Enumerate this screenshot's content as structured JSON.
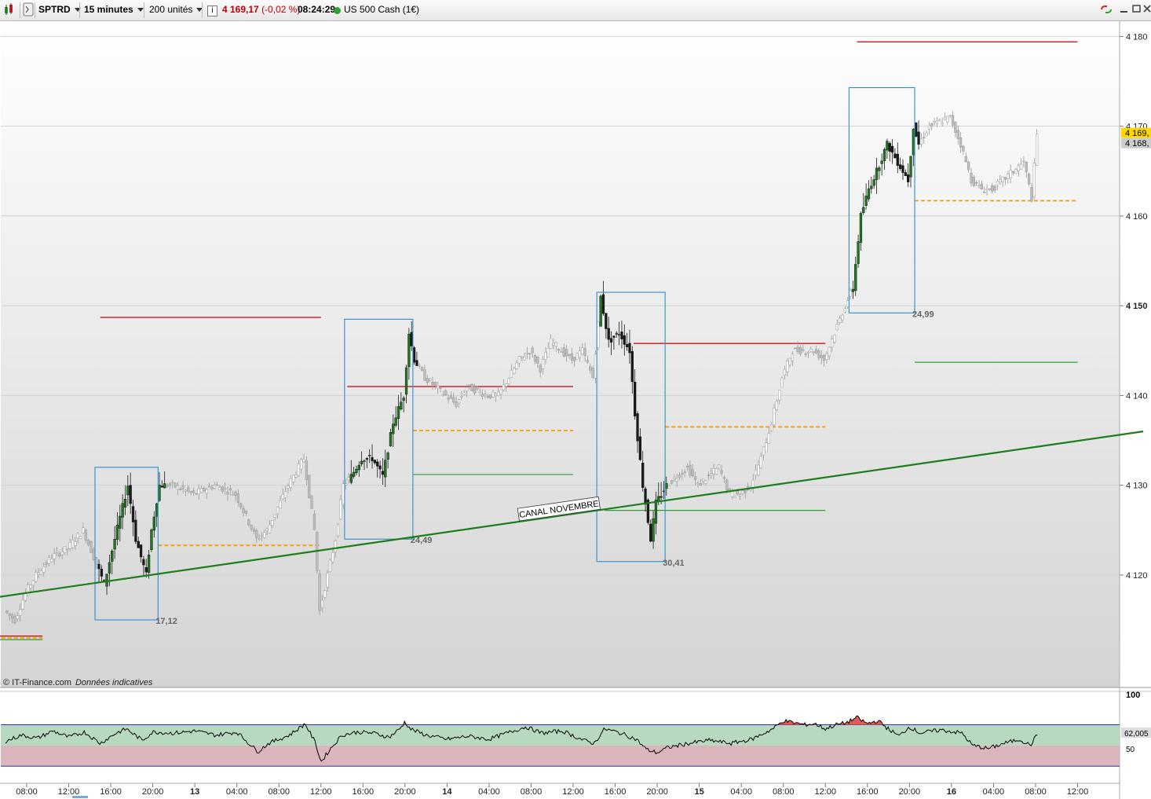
{
  "toolbar": {
    "symbol": "SPTRD",
    "interval": "15 minutes",
    "units": "200 unités",
    "info_icon": "i",
    "price": "4 169,17",
    "change": "(-0,02 %)",
    "time": "08:24:29",
    "instrument": "US 500 Cash (1€)",
    "icons": [
      "chart-type-icon",
      "indicator-icon",
      "info-icon",
      "status-dot-icon",
      "link-icon",
      "minimize-icon",
      "maximize-icon",
      "close-icon"
    ],
    "colors": {
      "price": "#c00000",
      "status_dot": "#2aa52a"
    }
  },
  "chart_data": [
    {
      "type": "candlestick",
      "instrument": "SPTRD",
      "timeframe": "15 minutes",
      "ylim": [
        4108,
        4181
      ],
      "y_ticks": [
        4120,
        4130,
        4140,
        4150,
        4160,
        4170,
        4180
      ],
      "y_tick_labels": [
        "4 120",
        "4 130",
        "4 140",
        "4 150",
        "4 160",
        "4 170",
        "4 180"
      ],
      "x_ticks": [
        {
          "label": "08:00",
          "day": "12",
          "hour": 8
        },
        {
          "label": "12:00",
          "day": "12",
          "hour": 12
        },
        {
          "label": "16:00",
          "day": "12",
          "hour": 16
        },
        {
          "label": "20:00",
          "day": "12",
          "hour": 20
        },
        {
          "label": "13",
          "day": "13",
          "hour": 0,
          "bold": true
        },
        {
          "label": "04:00",
          "day": "13",
          "hour": 4
        },
        {
          "label": "08:00",
          "day": "13",
          "hour": 8
        },
        {
          "label": "12:00",
          "day": "13",
          "hour": 12
        },
        {
          "label": "16:00",
          "day": "13",
          "hour": 16
        },
        {
          "label": "20:00",
          "day": "13",
          "hour": 20
        },
        {
          "label": "14",
          "day": "14",
          "hour": 0,
          "bold": true
        },
        {
          "label": "04:00",
          "day": "14",
          "hour": 4
        },
        {
          "label": "08:00",
          "day": "14",
          "hour": 8
        },
        {
          "label": "12:00",
          "day": "14",
          "hour": 12
        },
        {
          "label": "16:00",
          "day": "14",
          "hour": 16
        },
        {
          "label": "20:00",
          "day": "14",
          "hour": 20
        },
        {
          "label": "15",
          "day": "15",
          "hour": 0,
          "bold": true
        },
        {
          "label": "04:00",
          "day": "15",
          "hour": 4
        },
        {
          "label": "08:00",
          "day": "15",
          "hour": 8
        },
        {
          "label": "12:00",
          "day": "15",
          "hour": 12
        },
        {
          "label": "16:00",
          "day": "15",
          "hour": 16
        },
        {
          "label": "20:00",
          "day": "15",
          "hour": 20
        },
        {
          "label": "16",
          "day": "16",
          "hour": 0,
          "bold": true
        },
        {
          "label": "04:00",
          "day": "16",
          "hour": 4
        },
        {
          "label": "08:00",
          "day": "16",
          "hour": 8
        },
        {
          "label": "12:00",
          "day": "16",
          "hour": 12
        }
      ],
      "price_path": [
        {
          "t": "12 06:00",
          "p": 4116
        },
        {
          "t": "12 07:00",
          "p": 4115
        },
        {
          "t": "12 08:00",
          "p": 4118
        },
        {
          "t": "12 09:00",
          "p": 4120
        },
        {
          "t": "12 10:30",
          "p": 4122
        },
        {
          "t": "12 12:00",
          "p": 4123
        },
        {
          "t": "12 13:30",
          "p": 4125
        },
        {
          "t": "12 14:30",
          "p": 4122
        },
        {
          "t": "12 15:30",
          "p": 4119
        },
        {
          "t": "12 16:30",
          "p": 4124
        },
        {
          "t": "12 17:45",
          "p": 4130
        },
        {
          "t": "12 18:30",
          "p": 4124
        },
        {
          "t": "12 19:30",
          "p": 4120
        },
        {
          "t": "12 20:00",
          "p": 4125
        },
        {
          "t": "12 20:45",
          "p": 4130
        },
        {
          "t": "12 22:00",
          "p": 4130
        },
        {
          "t": "13 00:00",
          "p": 4129
        },
        {
          "t": "13 02:00",
          "p": 4130
        },
        {
          "t": "13 04:00",
          "p": 4129
        },
        {
          "t": "13 06:00",
          "p": 4124
        },
        {
          "t": "13 07:00",
          "p": 4125
        },
        {
          "t": "13 09:00",
          "p": 4130
        },
        {
          "t": "13 10:30",
          "p": 4133
        },
        {
          "t": "13 11:30",
          "p": 4125
        },
        {
          "t": "13 12:00",
          "p": 4116
        },
        {
          "t": "13 12:45",
          "p": 4120
        },
        {
          "t": "13 13:30",
          "p": 4124
        },
        {
          "t": "13 14:15",
          "p": 4130
        },
        {
          "t": "13 15:00",
          "p": 4131
        },
        {
          "t": "13 16:00",
          "p": 4133
        },
        {
          "t": "13 17:00",
          "p": 4133
        },
        {
          "t": "13 18:00",
          "p": 4131
        },
        {
          "t": "13 19:00",
          "p": 4137
        },
        {
          "t": "13 20:00",
          "p": 4140
        },
        {
          "t": "13 20:30",
          "p": 4147
        },
        {
          "t": "13 21:00",
          "p": 4144
        },
        {
          "t": "13 22:00",
          "p": 4142
        },
        {
          "t": "14 00:00",
          "p": 4140
        },
        {
          "t": "14 01:00",
          "p": 4139
        },
        {
          "t": "14 02:00",
          "p": 4141
        },
        {
          "t": "14 04:00",
          "p": 4140
        },
        {
          "t": "14 05:00",
          "p": 4140
        },
        {
          "t": "14 06:00",
          "p": 4142
        },
        {
          "t": "14 07:00",
          "p": 4144
        },
        {
          "t": "14 08:00",
          "p": 4145
        },
        {
          "t": "14 09:00",
          "p": 4143
        },
        {
          "t": "14 10:00",
          "p": 4146
        },
        {
          "t": "14 12:00",
          "p": 4144
        },
        {
          "t": "14 13:00",
          "p": 4145
        },
        {
          "t": "14 14:00",
          "p": 4142
        },
        {
          "t": "14 14:45",
          "p": 4151
        },
        {
          "t": "14 15:30",
          "p": 4146
        },
        {
          "t": "14 16:30",
          "p": 4147
        },
        {
          "t": "14 17:30",
          "p": 4145
        },
        {
          "t": "14 18:00",
          "p": 4138
        },
        {
          "t": "14 18:45",
          "p": 4130
        },
        {
          "t": "14 19:30",
          "p": 4124
        },
        {
          "t": "14 20:00",
          "p": 4128
        },
        {
          "t": "14 21:00",
          "p": 4130
        },
        {
          "t": "14 22:00",
          "p": 4131
        },
        {
          "t": "14 23:00",
          "p": 4132
        },
        {
          "t": "15 00:00",
          "p": 4130
        },
        {
          "t": "15 01:00",
          "p": 4131
        },
        {
          "t": "15 02:00",
          "p": 4132
        },
        {
          "t": "15 03:00",
          "p": 4129
        },
        {
          "t": "15 04:00",
          "p": 4129
        },
        {
          "t": "15 05:00",
          "p": 4130
        },
        {
          "t": "15 06:00",
          "p": 4133
        },
        {
          "t": "15 07:00",
          "p": 4137
        },
        {
          "t": "15 08:00",
          "p": 4142
        },
        {
          "t": "15 09:00",
          "p": 4145
        },
        {
          "t": "15 10:00",
          "p": 4145
        },
        {
          "t": "15 11:00",
          "p": 4145
        },
        {
          "t": "15 12:00",
          "p": 4144
        },
        {
          "t": "15 13:00",
          "p": 4147
        },
        {
          "t": "15 14:00",
          "p": 4150
        },
        {
          "t": "15 14:45",
          "p": 4152
        },
        {
          "t": "15 15:30",
          "p": 4160
        },
        {
          "t": "15 16:15",
          "p": 4163
        },
        {
          "t": "15 17:00",
          "p": 4165
        },
        {
          "t": "15 18:00",
          "p": 4168
        },
        {
          "t": "15 19:00",
          "p": 4166
        },
        {
          "t": "15 20:00",
          "p": 4164
        },
        {
          "t": "15 20:30",
          "p": 4170
        },
        {
          "t": "15 21:00",
          "p": 4168
        },
        {
          "t": "15 22:00",
          "p": 4170
        },
        {
          "t": "16 00:00",
          "p": 4171
        },
        {
          "t": "16 01:00",
          "p": 4168
        },
        {
          "t": "16 02:00",
          "p": 4164
        },
        {
          "t": "16 03:00",
          "p": 4163
        },
        {
          "t": "16 04:00",
          "p": 4163
        },
        {
          "t": "16 05:00",
          "p": 4164
        },
        {
          "t": "16 06:00",
          "p": 4165
        },
        {
          "t": "16 07:00",
          "p": 4166
        },
        {
          "t": "16 07:45",
          "p": 4162
        },
        {
          "t": "16 08:15",
          "p": 4169
        }
      ],
      "price_labels": [
        {
          "text": "4 169,",
          "value": 4169.17,
          "bg": "#ffd700"
        },
        {
          "text": "4 168,",
          "value": 4168.2,
          "bg": "#cccccc"
        }
      ],
      "range_boxes": [
        {
          "from": "12 14:30",
          "to": "12 20:30",
          "low": 4115,
          "high": 4132,
          "label": "17,12"
        },
        {
          "from": "13 14:15",
          "to": "13 20:45",
          "low": 4124,
          "high": 4148.5,
          "label": "24,49"
        },
        {
          "from": "14 14:15",
          "to": "14 20:45",
          "low": 4121.5,
          "high": 4151.5,
          "label": "30,41"
        },
        {
          "from": "15 14:15",
          "to": "15 20:30",
          "low": 4149.2,
          "high": 4174.3,
          "label": "24,99"
        }
      ],
      "horizontal_levels": [
        {
          "from": "12 05:00",
          "to": "12 09:30",
          "value": 4113.2,
          "color": "#cc0000",
          "style": "solid"
        },
        {
          "from": "12 05:00",
          "to": "12 09:30",
          "value": 4113.0,
          "color": "#ff9900",
          "style": "dashed"
        },
        {
          "from": "12 05:00",
          "to": "12 09:30",
          "value": 4112.8,
          "color": "#2e9e2e",
          "style": "solid"
        },
        {
          "from": "12 15:00",
          "to": "13 12:00",
          "value": 4148.7,
          "color": "#cc0000",
          "style": "solid"
        },
        {
          "from": "12 20:30",
          "to": "13 12:00",
          "value": 4123.3,
          "color": "#ff9900",
          "style": "dashed"
        },
        {
          "from": "13 14:30",
          "to": "14 12:00",
          "value": 4141.0,
          "color": "#cc0000",
          "style": "solid"
        },
        {
          "from": "13 20:45",
          "to": "14 12:00",
          "value": 4136.1,
          "color": "#ff9900",
          "style": "dashed"
        },
        {
          "from": "13 20:45",
          "to": "14 12:00",
          "value": 4131.2,
          "color": "#2e9e2e",
          "style": "solid"
        },
        {
          "from": "14 17:45",
          "to": "15 12:00",
          "value": 4145.8,
          "color": "#cc0000",
          "style": "solid"
        },
        {
          "from": "14 20:45",
          "to": "15 12:00",
          "value": 4136.5,
          "color": "#ff9900",
          "style": "dashed"
        },
        {
          "from": "14 15:00",
          "to": "15 12:00",
          "value": 4127.2,
          "color": "#2e9e2e",
          "style": "solid"
        },
        {
          "from": "15 15:00",
          "to": "16 12:00",
          "value": 4179.4,
          "color": "#cc0000",
          "style": "solid"
        },
        {
          "from": "15 20:30",
          "to": "16 12:00",
          "value": 4161.7,
          "color": "#ff9900",
          "style": "dashed"
        },
        {
          "from": "15 20:30",
          "to": "16 12:00",
          "value": 4143.7,
          "color": "#2e9e2e",
          "style": "solid"
        }
      ],
      "trendline": {
        "from": {
          "t": "12 05:00",
          "p": 4117.5
        },
        "to": {
          "t": "16 18:15",
          "p": 4136.0
        },
        "color": "#1e7d1e",
        "label": "CANAL NOVEMBRE"
      },
      "footer_text": "© IT-Finance.com",
      "footer_note": "Données indicatives"
    },
    {
      "type": "line",
      "name": "oscillator",
      "ylim": [
        15,
        100
      ],
      "y_tick_labels": [
        "100",
        "50"
      ],
      "upper_band": 70,
      "mid_band": 50,
      "lower_band": 30,
      "last_value_label": "62,005",
      "colors": {
        "upper_zone": "#b6d9c0",
        "lower_zone": "#dab6bc",
        "line": "#000000",
        "overbought_fill": "#e05a5a",
        "band": "#3333aa"
      },
      "values": [
        {
          "t": "12 06:00",
          "v": 54
        },
        {
          "t": "12 07:30",
          "v": 60
        },
        {
          "t": "12 09:00",
          "v": 57
        },
        {
          "t": "12 10:30",
          "v": 64
        },
        {
          "t": "12 12:00",
          "v": 58
        },
        {
          "t": "12 13:30",
          "v": 63
        },
        {
          "t": "12 15:00",
          "v": 52
        },
        {
          "t": "12 16:30",
          "v": 62
        },
        {
          "t": "12 17:30",
          "v": 66
        },
        {
          "t": "12 19:00",
          "v": 55
        },
        {
          "t": "12 20:00",
          "v": 63
        },
        {
          "t": "12 22:00",
          "v": 62
        },
        {
          "t": "13 00:00",
          "v": 64
        },
        {
          "t": "13 02:00",
          "v": 60
        },
        {
          "t": "13 04:00",
          "v": 63
        },
        {
          "t": "13 06:00",
          "v": 44
        },
        {
          "t": "13 07:00",
          "v": 52
        },
        {
          "t": "13 09:00",
          "v": 60
        },
        {
          "t": "13 10:30",
          "v": 71
        },
        {
          "t": "13 11:30",
          "v": 52
        },
        {
          "t": "13 12:00",
          "v": 34
        },
        {
          "t": "13 13:00",
          "v": 48
        },
        {
          "t": "13 14:00",
          "v": 60
        },
        {
          "t": "13 15:30",
          "v": 63
        },
        {
          "t": "13 17:00",
          "v": 62
        },
        {
          "t": "13 18:30",
          "v": 58
        },
        {
          "t": "13 19:30",
          "v": 66
        },
        {
          "t": "13 20:00",
          "v": 73
        },
        {
          "t": "13 20:30",
          "v": 66
        },
        {
          "t": "13 22:00",
          "v": 60
        },
        {
          "t": "14 00:00",
          "v": 56
        },
        {
          "t": "14 02:00",
          "v": 59
        },
        {
          "t": "14 04:00",
          "v": 56
        },
        {
          "t": "14 06:00",
          "v": 63
        },
        {
          "t": "14 07:30",
          "v": 68
        },
        {
          "t": "14 09:00",
          "v": 62
        },
        {
          "t": "14 11:00",
          "v": 64
        },
        {
          "t": "14 13:00",
          "v": 55
        },
        {
          "t": "14 14:00",
          "v": 52
        },
        {
          "t": "14 15:00",
          "v": 66
        },
        {
          "t": "14 16:30",
          "v": 62
        },
        {
          "t": "14 18:00",
          "v": 56
        },
        {
          "t": "14 19:00",
          "v": 46
        },
        {
          "t": "14 20:00",
          "v": 43
        },
        {
          "t": "14 21:00",
          "v": 48
        },
        {
          "t": "14 23:00",
          "v": 52
        },
        {
          "t": "15 01:00",
          "v": 55
        },
        {
          "t": "15 03:00",
          "v": 52
        },
        {
          "t": "15 05:00",
          "v": 56
        },
        {
          "t": "15 07:00",
          "v": 66
        },
        {
          "t": "15 08:00",
          "v": 74
        },
        {
          "t": "15 09:00",
          "v": 72
        },
        {
          "t": "15 10:00",
          "v": 70
        },
        {
          "t": "15 11:00",
          "v": 71
        },
        {
          "t": "15 12:00",
          "v": 66
        },
        {
          "t": "15 13:00",
          "v": 70
        },
        {
          "t": "15 14:00",
          "v": 72
        },
        {
          "t": "15 15:00",
          "v": 77
        },
        {
          "t": "15 16:00",
          "v": 71
        },
        {
          "t": "15 17:00",
          "v": 74
        },
        {
          "t": "15 18:00",
          "v": 66
        },
        {
          "t": "15 19:00",
          "v": 59
        },
        {
          "t": "15 20:00",
          "v": 68
        },
        {
          "t": "15 21:00",
          "v": 62
        },
        {
          "t": "15 23:00",
          "v": 65
        },
        {
          "t": "16 01:00",
          "v": 62
        },
        {
          "t": "16 02:00",
          "v": 50
        },
        {
          "t": "16 03:30",
          "v": 47
        },
        {
          "t": "16 05:00",
          "v": 52
        },
        {
          "t": "16 06:30",
          "v": 56
        },
        {
          "t": "16 07:30",
          "v": 50
        },
        {
          "t": "16 08:15",
          "v": 62
        }
      ]
    }
  ]
}
